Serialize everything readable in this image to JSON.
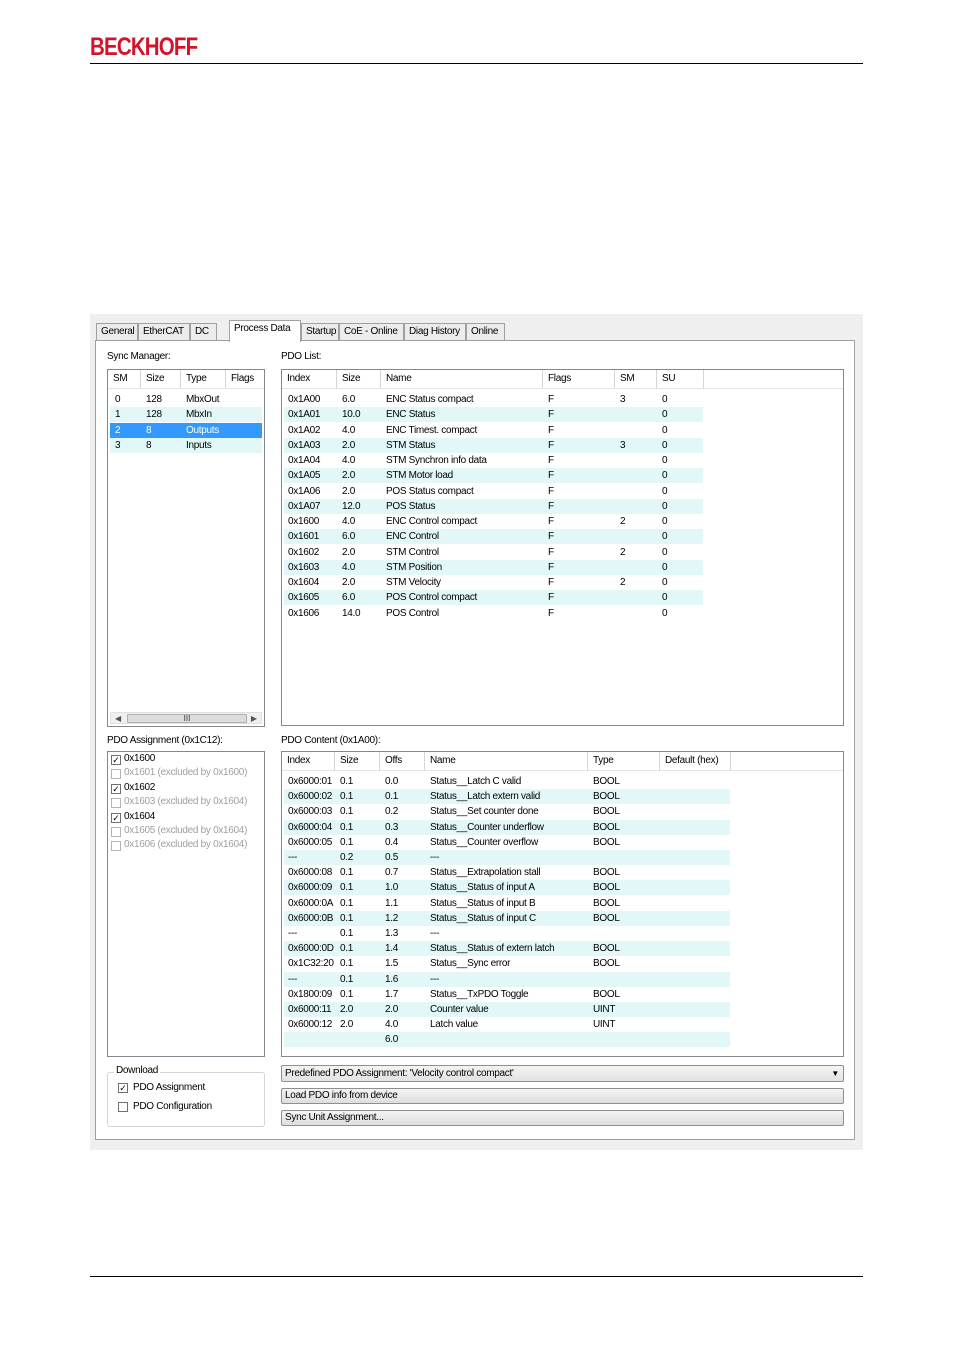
{
  "header": {
    "logo": "BECKHOFF"
  },
  "tabs": [
    {
      "label": "General",
      "active": false
    },
    {
      "label": "EtherCAT",
      "active": false
    },
    {
      "label": "DC",
      "active": false
    },
    {
      "label": "Process Data",
      "active": true
    },
    {
      "label": "Startup",
      "active": false
    },
    {
      "label": "CoE - Online",
      "active": false
    },
    {
      "label": "Diag History",
      "active": false
    },
    {
      "label": "Online",
      "active": false
    }
  ],
  "sync_manager": {
    "label": "Sync Manager:",
    "columns": [
      "SM",
      "Size",
      "Type",
      "Flags"
    ],
    "rows": [
      {
        "sm": "0",
        "size": "128",
        "type": "MbxOut",
        "flags": "",
        "selected": false
      },
      {
        "sm": "1",
        "size": "128",
        "type": "MbxIn",
        "flags": "",
        "selected": false
      },
      {
        "sm": "2",
        "size": "8",
        "type": "Outputs",
        "flags": "",
        "selected": true
      },
      {
        "sm": "3",
        "size": "8",
        "type": "Inputs",
        "flags": "",
        "selected": false
      }
    ],
    "scrollbar_thumb": "III"
  },
  "pdo_list": {
    "label": "PDO List:",
    "columns": [
      "Index",
      "Size",
      "Name",
      "Flags",
      "SM",
      "SU"
    ],
    "rows": [
      {
        "index": "0x1A00",
        "size": "6.0",
        "name": "ENC Status compact",
        "flags": "F",
        "sm": "3",
        "su": "0"
      },
      {
        "index": "0x1A01",
        "size": "10.0",
        "name": "ENC Status",
        "flags": "F",
        "sm": "",
        "su": "0"
      },
      {
        "index": "0x1A02",
        "size": "4.0",
        "name": "ENC Timest. compact",
        "flags": "F",
        "sm": "",
        "su": "0"
      },
      {
        "index": "0x1A03",
        "size": "2.0",
        "name": "STM Status",
        "flags": "F",
        "sm": "3",
        "su": "0"
      },
      {
        "index": "0x1A04",
        "size": "4.0",
        "name": "STM Synchron info data",
        "flags": "F",
        "sm": "",
        "su": "0"
      },
      {
        "index": "0x1A05",
        "size": "2.0",
        "name": "STM Motor load",
        "flags": "F",
        "sm": "",
        "su": "0"
      },
      {
        "index": "0x1A06",
        "size": "2.0",
        "name": "POS Status compact",
        "flags": "F",
        "sm": "",
        "su": "0"
      },
      {
        "index": "0x1A07",
        "size": "12.0",
        "name": "POS Status",
        "flags": "F",
        "sm": "",
        "su": "0"
      },
      {
        "index": "0x1600",
        "size": "4.0",
        "name": "ENC Control compact",
        "flags": "F",
        "sm": "2",
        "su": "0"
      },
      {
        "index": "0x1601",
        "size": "6.0",
        "name": "ENC Control",
        "flags": "F",
        "sm": "",
        "su": "0"
      },
      {
        "index": "0x1602",
        "size": "2.0",
        "name": "STM Control",
        "flags": "F",
        "sm": "2",
        "su": "0"
      },
      {
        "index": "0x1603",
        "size": "4.0",
        "name": "STM Position",
        "flags": "F",
        "sm": "",
        "su": "0"
      },
      {
        "index": "0x1604",
        "size": "2.0",
        "name": "STM Velocity",
        "flags": "F",
        "sm": "2",
        "su": "0"
      },
      {
        "index": "0x1605",
        "size": "6.0",
        "name": "POS Control compact",
        "flags": "F",
        "sm": "",
        "su": "0"
      },
      {
        "index": "0x1606",
        "size": "14.0",
        "name": "POS Control",
        "flags": "F",
        "sm": "",
        "su": "0"
      }
    ]
  },
  "pdo_assignment": {
    "label": "PDO Assignment (0x1C12):",
    "items": [
      {
        "label": "0x1600",
        "checked": true,
        "enabled": true
      },
      {
        "label": "0x1601 (excluded by 0x1600)",
        "checked": false,
        "enabled": false
      },
      {
        "label": "0x1602",
        "checked": true,
        "enabled": true
      },
      {
        "label": "0x1603 (excluded by 0x1604)",
        "checked": false,
        "enabled": false
      },
      {
        "label": "0x1604",
        "checked": true,
        "enabled": true
      },
      {
        "label": "0x1605 (excluded by 0x1604)",
        "checked": false,
        "enabled": false
      },
      {
        "label": "0x1606 (excluded by 0x1604)",
        "checked": false,
        "enabled": false
      }
    ]
  },
  "pdo_content": {
    "label": "PDO Content (0x1A00):",
    "columns": [
      "Index",
      "Size",
      "Offs",
      "Name",
      "Type",
      "Default (hex)"
    ],
    "rows": [
      {
        "index": "0x6000:01",
        "size": "0.1",
        "offs": "0.0",
        "name": "Status__Latch C valid",
        "type": "BOOL",
        "def": ""
      },
      {
        "index": "0x6000:02",
        "size": "0.1",
        "offs": "0.1",
        "name": "Status__Latch extern valid",
        "type": "BOOL",
        "def": ""
      },
      {
        "index": "0x6000:03",
        "size": "0.1",
        "offs": "0.2",
        "name": "Status__Set counter done",
        "type": "BOOL",
        "def": ""
      },
      {
        "index": "0x6000:04",
        "size": "0.1",
        "offs": "0.3",
        "name": "Status__Counter underflow",
        "type": "BOOL",
        "def": ""
      },
      {
        "index": "0x6000:05",
        "size": "0.1",
        "offs": "0.4",
        "name": "Status__Counter overflow",
        "type": "BOOL",
        "def": ""
      },
      {
        "index": "---",
        "size": "0.2",
        "offs": "0.5",
        "name": "---",
        "type": "",
        "def": ""
      },
      {
        "index": "0x6000:08",
        "size": "0.1",
        "offs": "0.7",
        "name": "Status__Extrapolation stall",
        "type": "BOOL",
        "def": ""
      },
      {
        "index": "0x6000:09",
        "size": "0.1",
        "offs": "1.0",
        "name": "Status__Status of input A",
        "type": "BOOL",
        "def": ""
      },
      {
        "index": "0x6000:0A",
        "size": "0.1",
        "offs": "1.1",
        "name": "Status__Status of input B",
        "type": "BOOL",
        "def": ""
      },
      {
        "index": "0x6000:0B",
        "size": "0.1",
        "offs": "1.2",
        "name": "Status__Status of input C",
        "type": "BOOL",
        "def": ""
      },
      {
        "index": "---",
        "size": "0.1",
        "offs": "1.3",
        "name": "---",
        "type": "",
        "def": ""
      },
      {
        "index": "0x6000:0D",
        "size": "0.1",
        "offs": "1.4",
        "name": "Status__Status of extern latch",
        "type": "BOOL",
        "def": ""
      },
      {
        "index": "0x1C32:20",
        "size": "0.1",
        "offs": "1.5",
        "name": "Status__Sync error",
        "type": "BOOL",
        "def": ""
      },
      {
        "index": "---",
        "size": "0.1",
        "offs": "1.6",
        "name": "---",
        "type": "",
        "def": ""
      },
      {
        "index": "0x1800:09",
        "size": "0.1",
        "offs": "1.7",
        "name": "Status__TxPDO Toggle",
        "type": "BOOL",
        "def": ""
      },
      {
        "index": "0x6000:11",
        "size": "2.0",
        "offs": "2.0",
        "name": "Counter value",
        "type": "UINT",
        "def": ""
      },
      {
        "index": "0x6000:12",
        "size": "2.0",
        "offs": "4.0",
        "name": "Latch value",
        "type": "UINT",
        "def": ""
      },
      {
        "index": "",
        "size": "",
        "offs": "6.0",
        "name": "",
        "type": "",
        "def": ""
      }
    ]
  },
  "download": {
    "label": "Download",
    "pdo_assignment_label": "PDO Assignment",
    "pdo_assignment_checked": true,
    "pdo_configuration_label": "PDO Configuration",
    "pdo_configuration_checked": false
  },
  "predefined": {
    "label": "Predefined PDO Assignment: 'Velocity control compact'"
  },
  "buttons": {
    "load_pdo": "Load PDO info from device",
    "sync_unit": "Sync Unit Assignment..."
  },
  "colors": {
    "row_alt": "#e2f8f8",
    "row_selected": "#3399ff",
    "logo": "#d3122b"
  }
}
